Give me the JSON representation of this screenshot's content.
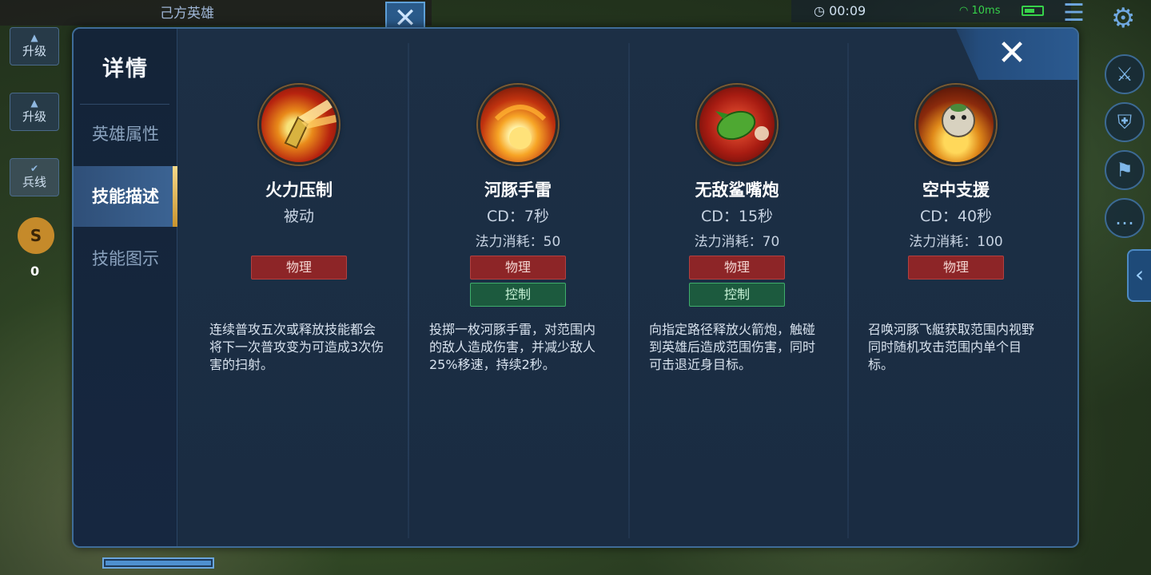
{
  "hud": {
    "allies_title": "己方英雄",
    "upgrade_label_1": "升级",
    "upgrade_label_2": "升级",
    "minion_label": "兵线",
    "coin_symbol": "S",
    "gold": "0",
    "timer": "00:09",
    "ping": "10ms"
  },
  "dialog": {
    "title": "详情",
    "tabs": [
      {
        "label": "英雄属性",
        "active": false
      },
      {
        "label": "技能描述",
        "active": true
      },
      {
        "label": "技能图示",
        "active": false
      }
    ],
    "close_label": "✕"
  },
  "skills": [
    {
      "name": "火力压制",
      "cd": "被动",
      "cost": "",
      "tags": [
        "物理"
      ],
      "description": "连续普攻五次或释放技能都会将下一次普攻变为可造成3次伤害的扫射。",
      "icon": "gun-burst-icon"
    },
    {
      "name": "河豚手雷",
      "cd": "CD：7秒",
      "cost": "法力消耗：50",
      "tags": [
        "物理",
        "控制"
      ],
      "description": "投掷一枚河豚手雷，对范围内的敌人造成伤害，并减少敌人25%移速，持续2秒。",
      "icon": "explosion-icon"
    },
    {
      "name": "无敌鲨嘴炮",
      "cd": "CD：15秒",
      "cost": "法力消耗：70",
      "tags": [
        "物理",
        "控制"
      ],
      "description": "向指定路径释放火箭炮，触碰到英雄后造成范围伤害，同时可击退近身目标。",
      "icon": "shark-rocket-icon"
    },
    {
      "name": "空中支援",
      "cd": "CD：40秒",
      "cost": "法力消耗：100",
      "tags": [
        "物理"
      ],
      "description": "召唤河豚飞艇获取范围内视野同时随机攻击范围内单个目标。",
      "icon": "pufferfish-airship-icon"
    }
  ]
}
